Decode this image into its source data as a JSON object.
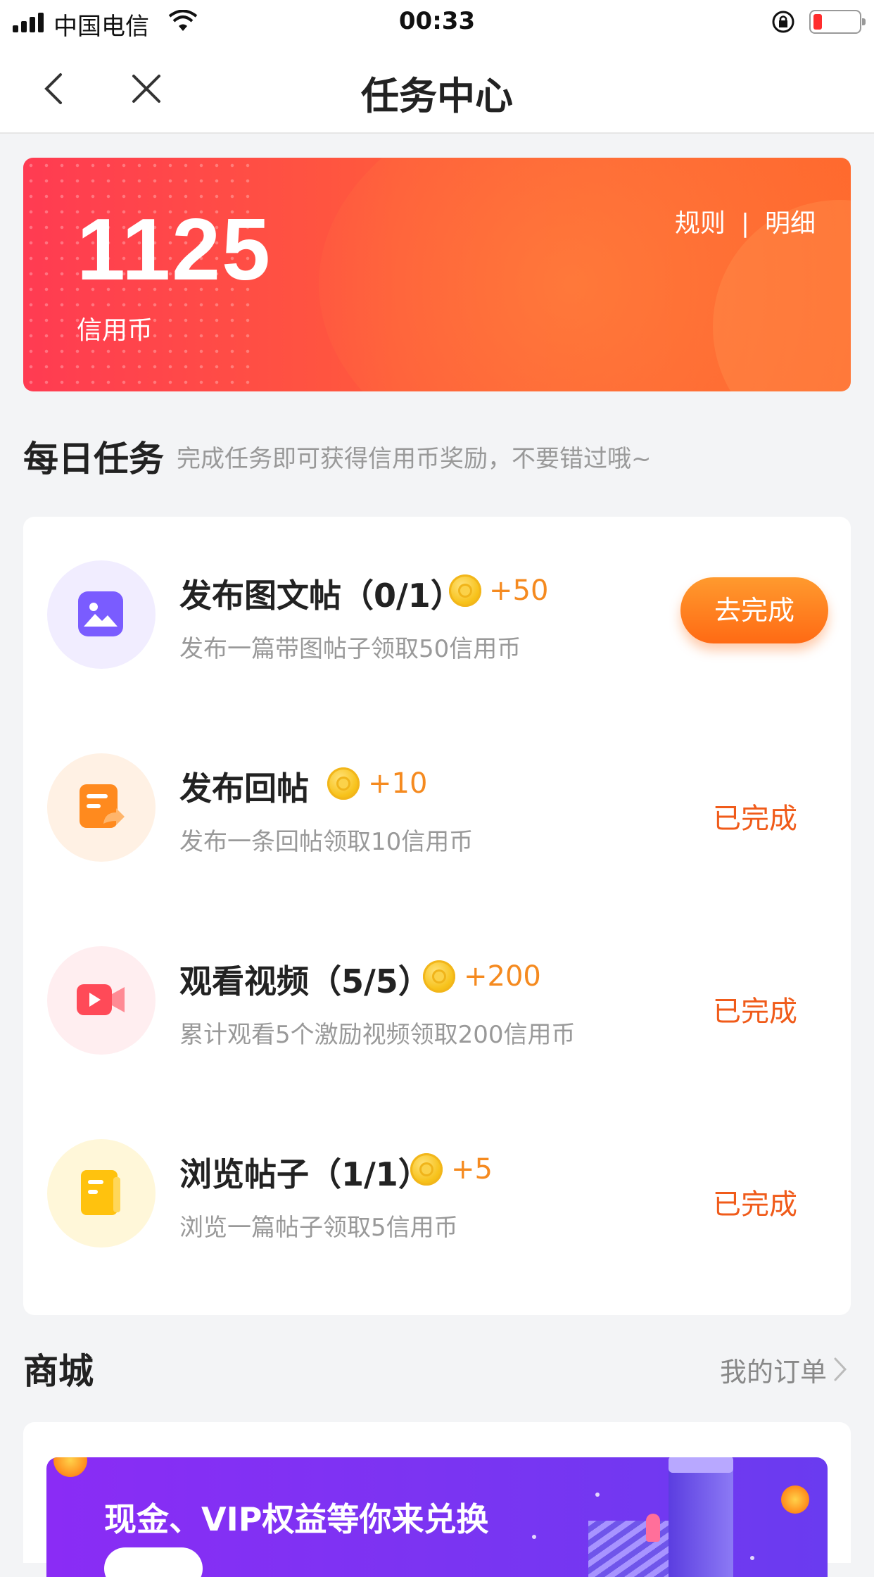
{
  "status_bar": {
    "carrier": "中国电信",
    "time": "00:33"
  },
  "nav": {
    "title": "任务中心"
  },
  "banner": {
    "amount": "1125",
    "unit": "信用币",
    "rules": "规则",
    "separator": "|",
    "details": "明细"
  },
  "daily": {
    "heading": "每日任务",
    "subtitle": "完成任务即可获得信用币奖励，不要错过哦~"
  },
  "tasks": [
    {
      "name": "发布图文帖（0/1）",
      "reward": "+50",
      "desc": "发布一篇带图帖子领取50信用币",
      "action": "去完成",
      "icon": "image-icon"
    },
    {
      "name": "发布回帖",
      "reward": "+10",
      "desc": "发布一条回帖领取10信用币",
      "action": "已完成",
      "icon": "reply-post-icon"
    },
    {
      "name": "观看视频（5/5）",
      "reward": "+200",
      "desc": "累计观看5个激励视频领取200信用币",
      "action": "已完成",
      "icon": "video-camera-icon"
    },
    {
      "name": "浏览帖子（1/1）",
      "reward": "+5",
      "desc": "浏览一篇帖子领取5信用币",
      "action": "已完成",
      "icon": "document-icon"
    }
  ],
  "mall": {
    "heading": "商城",
    "orders_link": "我的订单",
    "banner_text": "现金、VIP权益等你来兑换"
  },
  "colors": {
    "accent_orange": "#ff6a14",
    "done_text": "#f05b1a",
    "reward_text": "#f58a1f",
    "banner_red": "#ff3b52",
    "mall_purple": "#8a2cf5"
  }
}
